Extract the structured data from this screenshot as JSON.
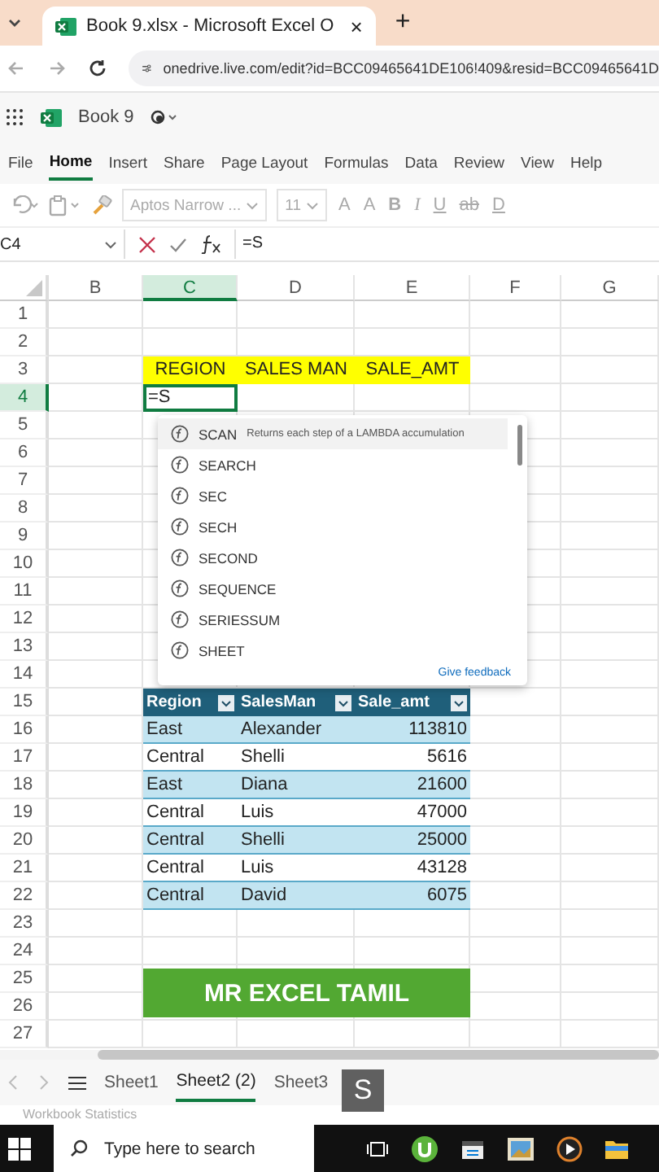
{
  "browser": {
    "tab_title": "Book 9.xlsx - Microsoft Excel O",
    "close": "×",
    "new_tab": "+",
    "url": "onedrive.live.com/edit?id=BCC09465641DE106!409&resid=BCC09465641D"
  },
  "app": {
    "doc_title": "Book 9"
  },
  "ribbon_tabs": [
    {
      "label": "File",
      "selected": false
    },
    {
      "label": "Home",
      "selected": true
    },
    {
      "label": "Insert",
      "selected": false
    },
    {
      "label": "Share",
      "selected": false
    },
    {
      "label": "Page Layout",
      "selected": false
    },
    {
      "label": "Formulas",
      "selected": false
    },
    {
      "label": "Data",
      "selected": false
    },
    {
      "label": "Review",
      "selected": false
    },
    {
      "label": "View",
      "selected": false
    },
    {
      "label": "Help",
      "selected": false
    }
  ],
  "toolbar": {
    "font": "Aptos Narrow ...",
    "size": "11",
    "format_buttons": [
      "A",
      "A",
      "B",
      "I",
      "U",
      "ab",
      "D"
    ]
  },
  "formula_bar": {
    "name_box": "C4",
    "formula": "=S"
  },
  "columns": [
    {
      "label": "B",
      "selected": false
    },
    {
      "label": "C",
      "selected": true
    },
    {
      "label": "D",
      "selected": false
    },
    {
      "label": "E",
      "selected": false
    },
    {
      "label": "F",
      "selected": false
    },
    {
      "label": "G",
      "selected": false
    }
  ],
  "row_numbers": [
    {
      "label": "1",
      "selected": false
    },
    {
      "label": "2",
      "selected": false
    },
    {
      "label": "3",
      "selected": false
    },
    {
      "label": "4",
      "selected": true
    },
    {
      "label": "5",
      "selected": false
    },
    {
      "label": "6",
      "selected": false
    },
    {
      "label": "7",
      "selected": false
    },
    {
      "label": "8",
      "selected": false
    },
    {
      "label": "9",
      "selected": false
    },
    {
      "label": "10",
      "selected": false
    },
    {
      "label": "11",
      "selected": false
    },
    {
      "label": "12",
      "selected": false
    },
    {
      "label": "13",
      "selected": false
    },
    {
      "label": "14",
      "selected": false
    },
    {
      "label": "15",
      "selected": false
    },
    {
      "label": "16",
      "selected": false
    },
    {
      "label": "17",
      "selected": false
    },
    {
      "label": "18",
      "selected": false
    },
    {
      "label": "19",
      "selected": false
    },
    {
      "label": "20",
      "selected": false
    },
    {
      "label": "21",
      "selected": false
    },
    {
      "label": "22",
      "selected": false
    },
    {
      "label": "23",
      "selected": false
    },
    {
      "label": "24",
      "selected": false
    },
    {
      "label": "25",
      "selected": false
    },
    {
      "label": "26",
      "selected": false
    },
    {
      "label": "27",
      "selected": false
    }
  ],
  "header_row": [
    "REGION",
    "SALES MAN",
    "SALE_AMT"
  ],
  "active_cell": {
    "value": "=S"
  },
  "autocomplete": {
    "items": [
      {
        "name": "SCAN",
        "description": "Returns each step of a LAMBDA accumulation",
        "selected": true
      },
      {
        "name": "SEARCH",
        "selected": false
      },
      {
        "name": "SEC",
        "selected": false
      },
      {
        "name": "SECH",
        "selected": false
      },
      {
        "name": "SECOND",
        "selected": false
      },
      {
        "name": "SEQUENCE",
        "selected": false
      },
      {
        "name": "SERIESSUM",
        "selected": false
      },
      {
        "name": "SHEET",
        "selected": false
      }
    ],
    "feedback_link": "Give feedback"
  },
  "table": {
    "columns": [
      "Region",
      "SalesMan",
      "Sale_amt"
    ],
    "rows": [
      [
        "East",
        "Alexander",
        "113810"
      ],
      [
        "Central",
        "Shelli",
        "5616"
      ],
      [
        "East",
        "Diana",
        "21600"
      ],
      [
        "Central",
        "Luis",
        "47000"
      ],
      [
        "Central",
        "Shelli",
        "25000"
      ],
      [
        "Central",
        "Luis",
        "43128"
      ],
      [
        "Central",
        "David",
        "6075"
      ]
    ]
  },
  "banner": "MR EXCEL TAMIL",
  "sheet_tabs": [
    {
      "label": "Sheet1",
      "selected": false
    },
    {
      "label": "Sheet2 (2)",
      "selected": true
    },
    {
      "label": "Sheet3",
      "selected": false
    }
  ],
  "key_overlay": "S",
  "status_bar": "Workbook Statistics",
  "taskbar": {
    "search_placeholder": "Type here to search"
  }
}
